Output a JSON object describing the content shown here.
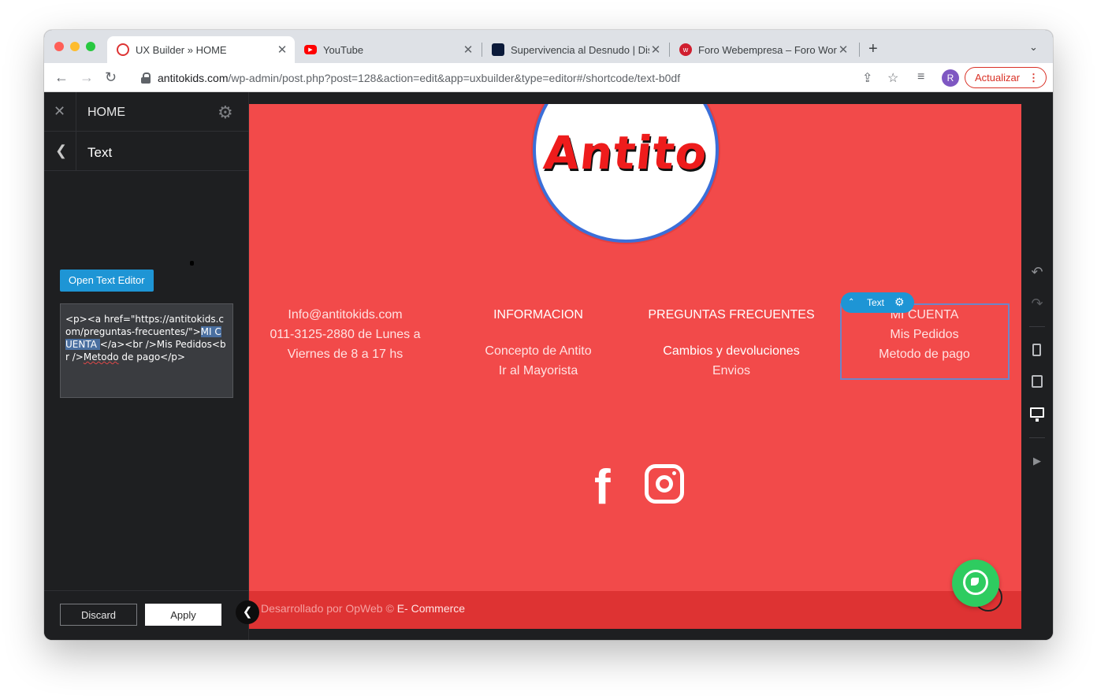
{
  "browser": {
    "tabs": [
      {
        "title": "UX Builder » HOME",
        "active": true
      },
      {
        "title": "YouTube",
        "active": false
      },
      {
        "title": "Supervivencia al Desnudo | Dis",
        "active": false
      },
      {
        "title": "Foro Webempresa – Foro Word",
        "active": false
      }
    ],
    "new_tab": "+",
    "url_host": "antitokids.com",
    "url_path": "/wp-admin/post.php?post=128&action=edit&app=uxbuilder&type=editor#/shortcode/text-b0df",
    "profile_initial": "R",
    "update_label": "Actualizar"
  },
  "sidebar": {
    "page_title": "HOME",
    "panel_title": "Text",
    "open_editor_label": "Open Text Editor",
    "code_before": "<p><a href=\"https://antitokids.com/preguntas-frecuentes/\">",
    "code_highlight": "MI CUENTA ",
    "code_mid": "</a><br />Mis Pedidos<br />",
    "code_squig": "Metodo",
    "code_after": " de pago</p>",
    "discard_label": "Discard",
    "apply_label": "Apply"
  },
  "site": {
    "logo_text": "Antito",
    "contact": {
      "email": "Info@antitokids.com",
      "phone": "011-3125-2880 de Lunes a",
      "hours": "Viernes de 8 a 17 hs"
    },
    "info": {
      "heading": "INFORMACION",
      "links": [
        "Concepto de Antito",
        "Ir al Mayorista"
      ]
    },
    "faq": {
      "heading": "PREGUNTAS FRECUENTES",
      "links": [
        "Cambios y devoluciones",
        "Envios"
      ]
    },
    "account": {
      "lines": [
        "MI CUENTA",
        "Mis Pedidos",
        "Metodo de pago"
      ]
    },
    "element_tag": "Text",
    "copyright_prefix": "Desarrollado por OpWeb ©",
    "copyright_link": "E- Commerce"
  },
  "colors": {
    "site_bg": "#f24a4a",
    "builder_bg": "#1e1f21",
    "accent": "#1e95d5",
    "whatsapp": "#2ecc60",
    "update": "#d93025"
  }
}
